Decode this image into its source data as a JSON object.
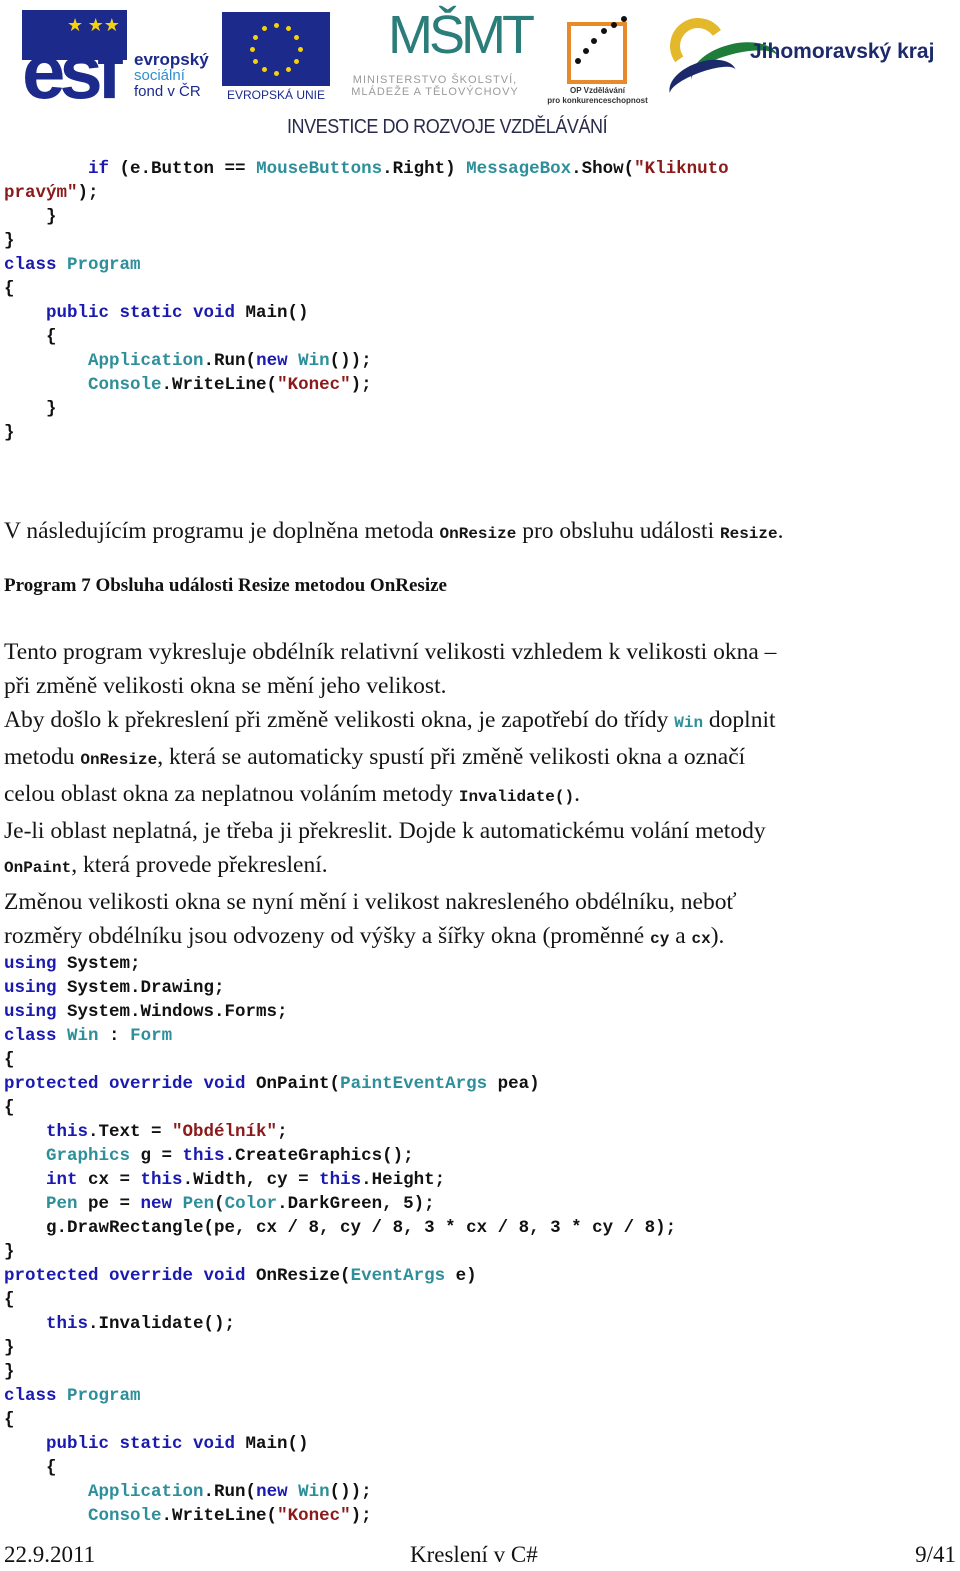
{
  "header": {
    "logos": {
      "esf": {
        "letters": "esf",
        "line1": "evropský",
        "line2": "sociální",
        "line3": "fond v ČR"
      },
      "eu": {
        "label": "EVROPSKÁ UNIE"
      },
      "msmt": {
        "mark": "MŠMT",
        "line1": "MINISTERSTVO ŠKOLSTVÍ,",
        "line2": "MLÁDEŽE A TĚLOVÝCHOVY"
      },
      "op": {
        "line1": "OP Vzdělávání",
        "line2": "pro konkurenceschopnost"
      },
      "jmk": {
        "name": "Jihomoravský kraj"
      }
    },
    "tagline": "INVESTICE DO ROZVOJE VZDĚLÁVÁNÍ",
    "colors": {
      "esf_blue": "#1c2a8c",
      "eu_yellow": "#f5d20c",
      "msmt_teal": "#2b7d7a",
      "op_orange": "#e98a2a",
      "jmk_green": "#1f7d3a",
      "jmk_yellow": "#e3b82a"
    }
  },
  "code_colors": {
    "keyword": "#1a1ab0",
    "type": "#2e8f9a",
    "string": "#8b1a1a",
    "plain": "#111111"
  },
  "code_top": [
    [
      {
        "t": "        "
      },
      {
        "t": "if",
        "c": "kw"
      },
      {
        "t": " (e.Button == "
      },
      {
        "t": "MouseButtons",
        "c": "ty"
      },
      {
        "t": ".Right) "
      },
      {
        "t": "MessageBox",
        "c": "ty"
      },
      {
        "t": ".Show("
      },
      {
        "t": "\"Kliknuto",
        "c": "st"
      }
    ],
    [
      {
        "t": "pravým\"",
        "c": "st"
      },
      {
        "t": ");"
      }
    ],
    [
      {
        "t": "    }"
      }
    ],
    [
      {
        "t": "}"
      }
    ],
    [
      {
        "t": "class",
        "c": "kw"
      },
      {
        "t": " "
      },
      {
        "t": "Program",
        "c": "ty"
      }
    ],
    [
      {
        "t": "{"
      }
    ],
    [
      {
        "t": "    "
      },
      {
        "t": "public static void",
        "c": "kw"
      },
      {
        "t": " Main()"
      }
    ],
    [
      {
        "t": "    {"
      }
    ],
    [
      {
        "t": "        "
      },
      {
        "t": "Application",
        "c": "ty"
      },
      {
        "t": ".Run("
      },
      {
        "t": "new",
        "c": "kw"
      },
      {
        "t": " "
      },
      {
        "t": "Win",
        "c": "ty"
      },
      {
        "t": "());"
      }
    ],
    [
      {
        "t": "        "
      },
      {
        "t": "Console",
        "c": "ty"
      },
      {
        "t": ".WriteLine("
      },
      {
        "t": "\"Konec\"",
        "c": "st"
      },
      {
        "t": ");"
      }
    ],
    [
      {
        "t": "    }"
      }
    ],
    [
      {
        "t": "}"
      }
    ]
  ],
  "intro": [
    {
      "t": "V následujícím programu je doplněna metoda "
    },
    {
      "t": "OnResize",
      "m": true
    },
    {
      "t": " pro obsluhu události "
    },
    {
      "t": "Resize",
      "m": true
    },
    {
      "t": "."
    }
  ],
  "caption": "Program 7 Obsluha události Resize metodou OnResize",
  "description": [
    [
      {
        "t": "Tento program vykresluje obdélník relativní velikosti vzhledem k velikosti okna –"
      }
    ],
    [
      {
        "t": "při změně velikosti okna se mění jeho velikost."
      }
    ],
    [
      {
        "t": "Aby došlo k překreslení při změně velikosti okna, je zapotřebí do třídy "
      },
      {
        "t": "Win",
        "m": true,
        "ty": true
      },
      {
        "t": " doplnit"
      }
    ],
    [
      {
        "t": "metodu "
      },
      {
        "t": "OnResize",
        "m": true
      },
      {
        "t": ", která se automaticky spustí při změně velikosti okna a označí"
      }
    ],
    [
      {
        "t": "celou oblast okna za neplatnou voláním metody "
      },
      {
        "t": "Invalidate()",
        "m": true
      },
      {
        "t": "."
      }
    ],
    [
      {
        "t": "Je-li oblast neplatná, je třeba ji překreslit. Dojde k automatickému volání metody"
      }
    ],
    [
      {
        "t": "OnPaint",
        "m": true
      },
      {
        "t": ", která provede překreslení."
      }
    ],
    [
      {
        "t": "Změnou velikosti okna se nyní mění i velikost nakresleného obdélníku, neboť"
      }
    ],
    [
      {
        "t": "rozměry obdélníku jsou odvozeny od výšky a šířky okna (proměnné "
      },
      {
        "t": "cy",
        "m": true
      },
      {
        "t": " a "
      },
      {
        "t": "cx",
        "m": true
      },
      {
        "t": ")."
      }
    ]
  ],
  "code_main": [
    [
      {
        "t": "using",
        "c": "kw"
      },
      {
        "t": " System;"
      }
    ],
    [
      {
        "t": "using",
        "c": "kw"
      },
      {
        "t": " System.Drawing;"
      }
    ],
    [
      {
        "t": "using",
        "c": "kw"
      },
      {
        "t": " System.Windows.Forms;"
      }
    ],
    [
      {
        "t": "class",
        "c": "kw"
      },
      {
        "t": " "
      },
      {
        "t": "Win",
        "c": "ty"
      },
      {
        "t": " : "
      },
      {
        "t": "Form",
        "c": "ty"
      }
    ],
    [
      {
        "t": "{"
      }
    ],
    [
      {
        "t": "protected override void",
        "c": "kw"
      },
      {
        "t": " OnPaint("
      },
      {
        "t": "PaintEventArgs",
        "c": "ty"
      },
      {
        "t": " pea)"
      }
    ],
    [
      {
        "t": "{"
      }
    ],
    [
      {
        "t": "    "
      },
      {
        "t": "this",
        "c": "kw"
      },
      {
        "t": ".Text = "
      },
      {
        "t": "\"Obdélník\"",
        "c": "st"
      },
      {
        "t": ";"
      }
    ],
    [
      {
        "t": "    "
      },
      {
        "t": "Graphics",
        "c": "ty"
      },
      {
        "t": " g = "
      },
      {
        "t": "this",
        "c": "kw"
      },
      {
        "t": ".CreateGraphics();"
      }
    ],
    [
      {
        "t": "    "
      },
      {
        "t": "int",
        "c": "kw"
      },
      {
        "t": " cx = "
      },
      {
        "t": "this",
        "c": "kw"
      },
      {
        "t": ".Width, cy = "
      },
      {
        "t": "this",
        "c": "kw"
      },
      {
        "t": ".Height;"
      }
    ],
    [
      {
        "t": "    "
      },
      {
        "t": "Pen",
        "c": "ty"
      },
      {
        "t": " pe = "
      },
      {
        "t": "new",
        "c": "kw"
      },
      {
        "t": " "
      },
      {
        "t": "Pen",
        "c": "ty"
      },
      {
        "t": "("
      },
      {
        "t": "Color",
        "c": "ty"
      },
      {
        "t": ".DarkGreen, 5);"
      }
    ],
    [
      {
        "t": "    g.DrawRectangle(pe, cx / 8, cy / 8, 3 * cx / 8, 3 * cy / 8);"
      }
    ],
    [
      {
        "t": "}"
      }
    ],
    [
      {
        "t": "protected override void",
        "c": "kw"
      },
      {
        "t": " OnResize("
      },
      {
        "t": "EventArgs",
        "c": "ty"
      },
      {
        "t": " e)"
      }
    ],
    [
      {
        "t": "{"
      }
    ],
    [
      {
        "t": "    "
      },
      {
        "t": "this",
        "c": "kw"
      },
      {
        "t": ".Invalidate();"
      }
    ],
    [
      {
        "t": "}"
      }
    ],
    [
      {
        "t": "}"
      }
    ],
    [
      {
        "t": "class",
        "c": "kw"
      },
      {
        "t": " "
      },
      {
        "t": "Program",
        "c": "ty"
      }
    ],
    [
      {
        "t": "{"
      }
    ],
    [
      {
        "t": "    "
      },
      {
        "t": "public static void",
        "c": "kw"
      },
      {
        "t": " Main()"
      }
    ],
    [
      {
        "t": "    {"
      }
    ],
    [
      {
        "t": "        "
      },
      {
        "t": "Application",
        "c": "ty"
      },
      {
        "t": ".Run("
      },
      {
        "t": "new",
        "c": "kw"
      },
      {
        "t": " "
      },
      {
        "t": "Win",
        "c": "ty"
      },
      {
        "t": "());"
      }
    ],
    [
      {
        "t": "        "
      },
      {
        "t": "Console",
        "c": "ty"
      },
      {
        "t": ".WriteLine("
      },
      {
        "t": "\"Konec\"",
        "c": "st"
      },
      {
        "t": ");"
      }
    ]
  ],
  "footer": {
    "date": "22.9.2011",
    "title": "Kreslení v C#",
    "page": "9/41"
  }
}
